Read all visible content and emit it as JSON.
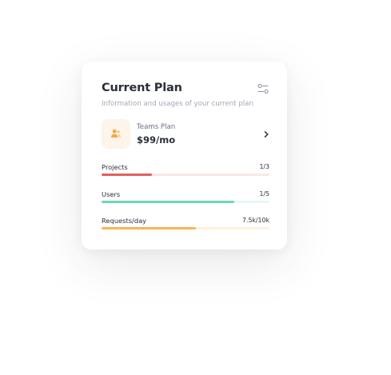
{
  "card": {
    "title": "Current Plan",
    "subtitle": "Information and usages of your current plan",
    "settings_icon": "sliders-icon"
  },
  "plan": {
    "name": "Teams Plan",
    "price": "$99/mo",
    "icon": "team-users-icon",
    "chevron_icon": "chevron-right-icon"
  },
  "usage": [
    {
      "label": "Projects",
      "value": "1/3",
      "fraction": 0.3,
      "color": "#e0605e",
      "track": "#fbe7e6"
    },
    {
      "label": "Users",
      "value": "1/5",
      "fraction": 0.79,
      "color": "#6fd8b0",
      "track": "#e6f8f1"
    },
    {
      "label": "Requests/day",
      "value": "7.5k/10k",
      "fraction": 0.56,
      "color": "#f6b656",
      "track": "#fdf1de"
    }
  ],
  "colors": {
    "plan_icon_bg": "#fdf4ea",
    "plan_icon": "#f4a64a",
    "text_dark": "#2a2f3a",
    "text_muted": "#a3a9b5"
  }
}
